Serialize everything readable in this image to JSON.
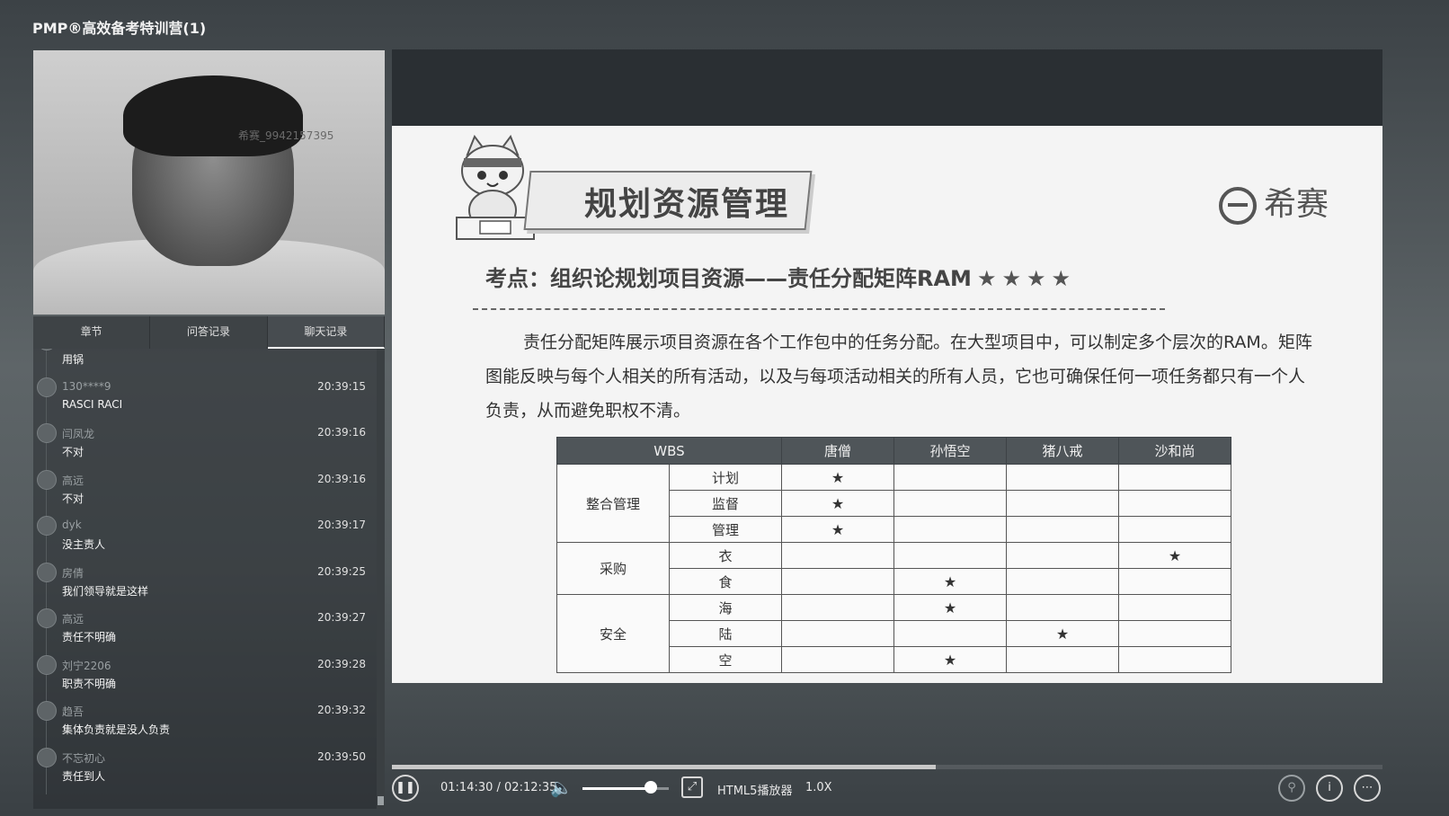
{
  "app": {
    "title": "PMP®高效备考特训营(1)"
  },
  "camera": {
    "watermark": "希赛_9942157395"
  },
  "tabs": [
    {
      "label": "章节"
    },
    {
      "label": "问答记录"
    },
    {
      "label": "聊天记录"
    }
  ],
  "chat": [
    {
      "name": "",
      "time": "",
      "text": "用锅"
    },
    {
      "name": "130****9",
      "time": "20:39:15",
      "text": "RASCI RACI"
    },
    {
      "name": "闫凤龙",
      "time": "20:39:16",
      "text": "不对"
    },
    {
      "name": "高远",
      "time": "20:39:16",
      "text": "不对"
    },
    {
      "name": "dyk",
      "time": "20:39:17",
      "text": "没主责人"
    },
    {
      "name": "房倩",
      "time": "20:39:25",
      "text": "我们领导就是这样"
    },
    {
      "name": "高远",
      "time": "20:39:27",
      "text": "责任不明确"
    },
    {
      "name": "刘宁2206",
      "time": "20:39:28",
      "text": "职责不明确"
    },
    {
      "name": "趋吾",
      "time": "20:39:32",
      "text": "集体负责就是没人负责"
    },
    {
      "name": "不忘初心",
      "time": "20:39:50",
      "text": "责任到人"
    }
  ],
  "slide": {
    "title": "规划资源管理",
    "logo_text": "希赛",
    "keypoint": "考点：组织论规划项目资源——责任分配矩阵RAM",
    "keypoint_stars": "★★★★",
    "paragraph": "责任分配矩阵展示项目资源在各个工作包中的任务分配。在大型项目中，可以制定多个层次的RAM。矩阵图能反映与每个人相关的所有活动，以及与每项活动相关的所有人员，它也可确保任何一项任务都只有一个人负责，从而避免职权不清。",
    "table": {
      "headers": [
        "WBS",
        "唐僧",
        "孙悟空",
        "猪八戒",
        "沙和尚"
      ],
      "groups": [
        {
          "name": "整合管理",
          "rows": [
            {
              "task": "计划",
              "marks": [
                "★",
                "",
                "",
                ""
              ]
            },
            {
              "task": "监督",
              "marks": [
                "★",
                "",
                "",
                ""
              ]
            },
            {
              "task": "管理",
              "marks": [
                "★",
                "",
                "",
                ""
              ]
            }
          ]
        },
        {
          "name": "采购",
          "rows": [
            {
              "task": "衣",
              "marks": [
                "",
                "",
                "",
                "★"
              ]
            },
            {
              "task": "食",
              "marks": [
                "",
                "★",
                "",
                ""
              ]
            }
          ]
        },
        {
          "name": "安全",
          "rows": [
            {
              "task": "海",
              "marks": [
                "",
                "★",
                "",
                ""
              ]
            },
            {
              "task": "陆",
              "marks": [
                "",
                "",
                "★",
                ""
              ]
            },
            {
              "task": "空",
              "marks": [
                "",
                "★",
                "",
                ""
              ]
            }
          ]
        }
      ]
    }
  },
  "player": {
    "time_display": "01:14:30 / 02:12:35",
    "player_label": "HTML5播放器",
    "speed": "1.0X",
    "progress": 0.549,
    "volume": 0.79
  }
}
